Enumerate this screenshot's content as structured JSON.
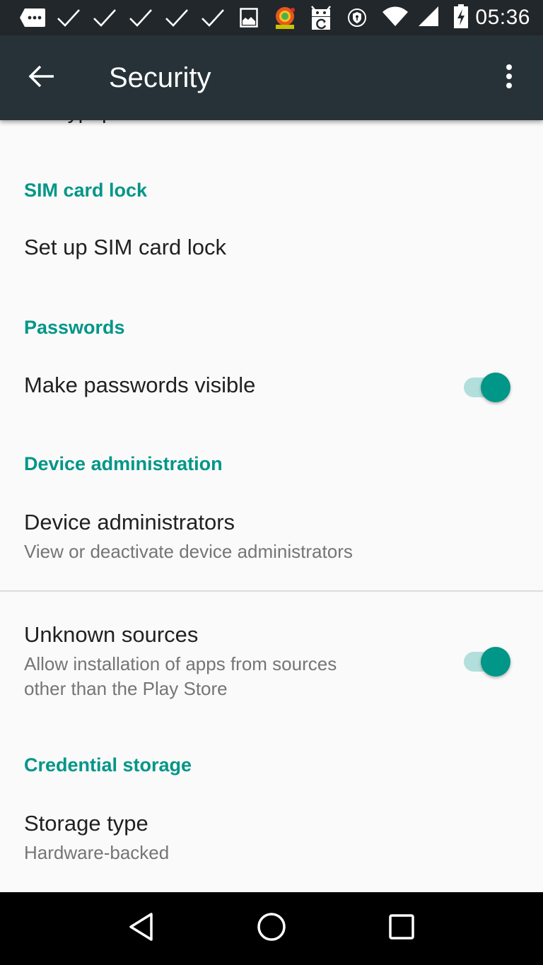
{
  "status_bar": {
    "time": "05:36",
    "notification_icons": [
      "more-notifications-icon",
      "check-icon",
      "check-icon",
      "check-icon",
      "check-icon",
      "check-icon",
      "image-icon",
      "app-manager-icon",
      "fdroid-update-icon",
      "vpn-shield-icon"
    ],
    "system_icons": [
      "wifi-icon",
      "cell-signal-icon",
      "battery-charging-icon"
    ]
  },
  "toolbar": {
    "title": "Security",
    "back_icon": "arrow-back-icon",
    "overflow_icon": "more-vert-icon"
  },
  "colors": {
    "toolbar_bg": "#263238",
    "status_bar_bg": "#22272b",
    "accent": "#009688",
    "switch_track_on": "#b2dfdb",
    "background": "#fafafa",
    "primary_text": "#212121",
    "secondary_text": "#757575"
  },
  "preferences": {
    "clipped_item": "Encrypt phone",
    "sections": [
      {
        "category": "SIM card lock",
        "items": [
          {
            "title": "Set up SIM card lock"
          }
        ]
      },
      {
        "category": "Passwords",
        "items": [
          {
            "title": "Make passwords visible",
            "switch": true
          }
        ]
      },
      {
        "category": "Device administration",
        "items": [
          {
            "title": "Device administrators",
            "summary": "View or deactivate device administrators"
          },
          {
            "title": "Unknown sources",
            "summary_line1": "Allow installation of apps from sources",
            "summary_line2": "other than the Play Store",
            "switch": true
          }
        ]
      },
      {
        "category": "Credential storage",
        "items": [
          {
            "title": "Storage type",
            "summary": "Hardware-backed"
          }
        ]
      }
    ]
  },
  "nav_bar": {
    "buttons": [
      "back-nav-icon",
      "home-icon",
      "recents-icon"
    ]
  }
}
